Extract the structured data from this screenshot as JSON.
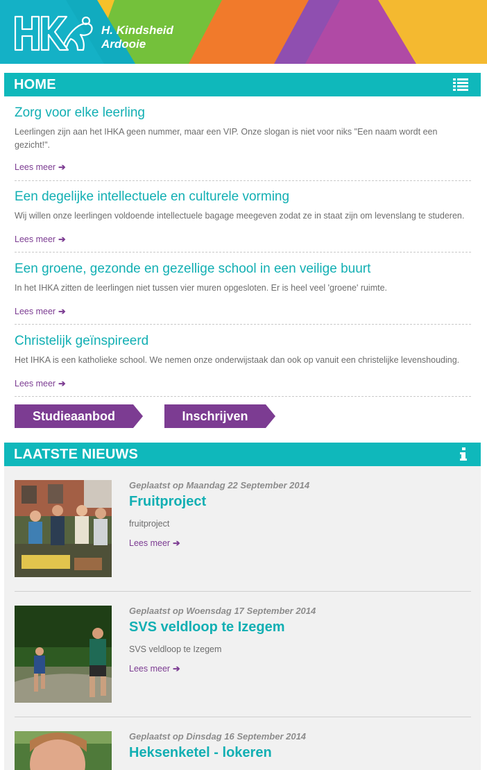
{
  "header": {
    "logo_text": "IHKA",
    "brand_line1": "H. Kindsheid",
    "brand_line2": "Ardooie"
  },
  "home": {
    "title": "HOME",
    "menu_icon": "list-icon",
    "items": [
      {
        "title": "Zorg voor elke leerling",
        "text": "Leerlingen zijn aan het IHKA geen nummer, maar een VIP. Onze slogan is niet voor niks \"Een naam wordt een gezicht!\".",
        "more": "Lees meer"
      },
      {
        "title": "Een degelijke intellectuele en culturele vorming",
        "text": "Wij willen onze leerlingen voldoende intellectuele bagage meegeven zodat ze in staat zijn om levenslang te studeren.",
        "more": "Lees meer"
      },
      {
        "title": "Een groene, gezonde en gezellige school in een veilige buurt",
        "text": "In het IHKA zitten de leerlingen niet tussen vier muren opgesloten. Er is heel veel 'groene' ruimte.",
        "more": "Lees meer"
      },
      {
        "title": "Christelijk geïnspireerd",
        "text": "Het IHKA is een katholieke school. We nemen onze onderwijstaak dan ook op vanuit een christelijke levenshouding.",
        "more": "Lees meer"
      }
    ],
    "buttons": [
      "Studieaanbod",
      "Inschrijven"
    ]
  },
  "news": {
    "title": "LAATSTE NIEUWS",
    "info_icon": "info-icon",
    "items": [
      {
        "meta": "Geplaatst op Maandag 22 September 2014",
        "title": "Fruitproject",
        "summary": "fruitproject",
        "more": "Lees meer"
      },
      {
        "meta": "Geplaatst op Woensdag 17 September 2014",
        "title": "SVS veldloop te Izegem",
        "summary": "SVS veldloop te Izegem",
        "more": "Lees meer"
      },
      {
        "meta": "Geplaatst op Dinsdag 16 September 2014",
        "title": "Heksenketel - lokeren"
      }
    ]
  },
  "colors": {
    "teal": "#0fb8bb",
    "purple": "#7c3c92",
    "news_background": "#f1f1f1"
  }
}
